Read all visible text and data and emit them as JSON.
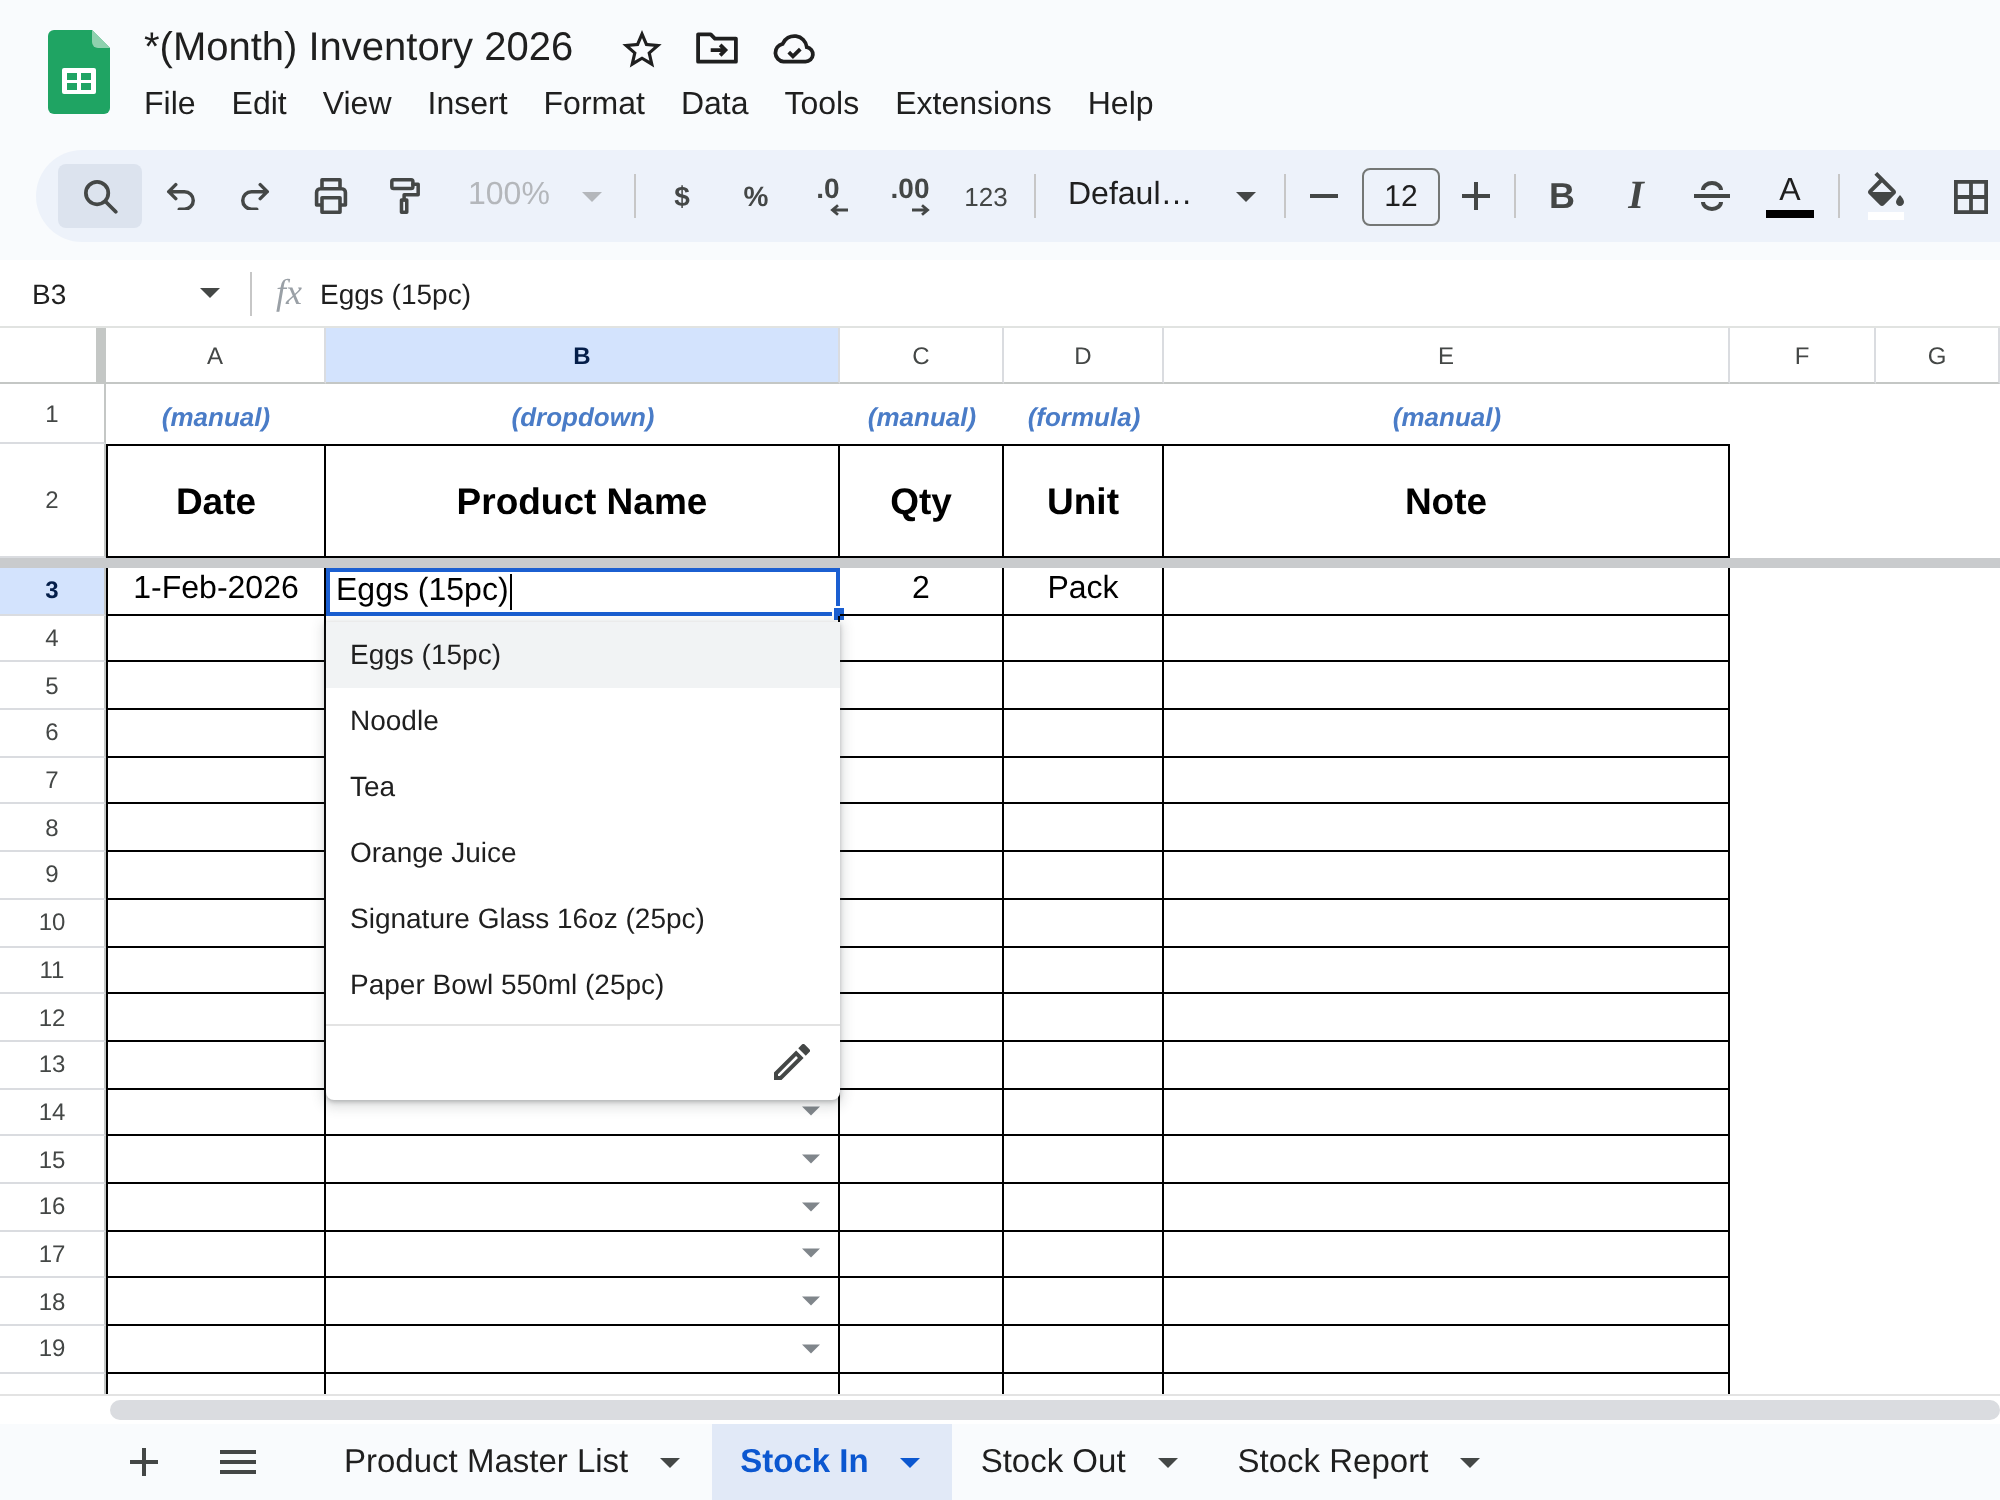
{
  "document": {
    "title": "*(Month) Inventory 2026"
  },
  "menu": [
    "File",
    "Edit",
    "View",
    "Insert",
    "Format",
    "Data",
    "Tools",
    "Extensions",
    "Help"
  ],
  "toolbar": {
    "search": {
      "selected": true
    },
    "zoom": {
      "value": "100%",
      "disabled": true
    },
    "currency": "$",
    "percent": "%",
    "decrease_decimals": ".0",
    "increase_decimals": ".00",
    "number_format": "123",
    "font": "Defaul…",
    "font_size": "12",
    "bold": "B",
    "italic": "I",
    "text_color": "A"
  },
  "formula_bar": {
    "cell_reference": "B3",
    "function_label": "fx",
    "value": "Eggs (15pc)"
  },
  "sheet": {
    "columns": [
      {
        "label": "A",
        "selected": false
      },
      {
        "label": "B",
        "selected": true
      },
      {
        "label": "C",
        "selected": false
      },
      {
        "label": "D",
        "selected": false
      },
      {
        "label": "E",
        "selected": false
      },
      {
        "label": "F",
        "selected": false
      },
      {
        "label": "G",
        "selected": false
      }
    ],
    "rows": [
      {
        "label": "1",
        "kind": "hint",
        "selected": false,
        "dropdown": false,
        "cells": [
          {
            "text": "(manual)",
            "active": false
          },
          {
            "text": "(dropdown)",
            "active": false
          },
          {
            "text": "(manual)",
            "active": false
          },
          {
            "text": "(formula)",
            "active": false
          },
          {
            "text": "(manual)",
            "active": false
          }
        ]
      },
      {
        "label": "2",
        "kind": "header",
        "selected": false,
        "dropdown": false,
        "cells": [
          {
            "text": "Date",
            "active": false
          },
          {
            "text": "Product Name",
            "active": false
          },
          {
            "text": "Qty",
            "active": false
          },
          {
            "text": "Unit",
            "active": false
          },
          {
            "text": "Note",
            "active": false
          }
        ]
      },
      {
        "label": "3",
        "kind": "data",
        "selected": true,
        "dropdown": false,
        "cells": [
          {
            "text": "1-Feb-2026",
            "active": false
          },
          {
            "text": "Eggs (15pc)",
            "active": true
          },
          {
            "text": "2",
            "active": false
          },
          {
            "text": "Pack",
            "active": false
          },
          {
            "active": false
          }
        ]
      },
      {
        "label": "4",
        "kind": "data",
        "selected": false,
        "dropdown": false
      },
      {
        "label": "5",
        "kind": "data",
        "selected": false,
        "dropdown": false
      },
      {
        "label": "6",
        "kind": "data",
        "selected": false,
        "dropdown": false
      },
      {
        "label": "7",
        "kind": "data",
        "selected": false,
        "dropdown": false
      },
      {
        "label": "8",
        "kind": "data",
        "selected": false,
        "dropdown": false
      },
      {
        "label": "9",
        "kind": "data",
        "selected": false,
        "dropdown": false
      },
      {
        "label": "10",
        "kind": "data",
        "selected": false,
        "dropdown": false
      },
      {
        "label": "11",
        "kind": "data",
        "selected": false,
        "dropdown": false
      },
      {
        "label": "12",
        "kind": "data",
        "selected": false,
        "dropdown": false
      },
      {
        "label": "13",
        "kind": "data",
        "selected": false,
        "dropdown": false
      },
      {
        "label": "14",
        "kind": "data",
        "selected": false,
        "dropdown": true
      },
      {
        "label": "15",
        "kind": "data",
        "selected": false,
        "dropdown": true
      },
      {
        "label": "16",
        "kind": "data",
        "selected": false,
        "dropdown": true
      },
      {
        "label": "17",
        "kind": "data",
        "selected": false,
        "dropdown": true
      },
      {
        "label": "18",
        "kind": "data",
        "selected": false,
        "dropdown": true
      },
      {
        "label": "19",
        "kind": "data",
        "selected": false,
        "dropdown": true
      }
    ]
  },
  "dropdown_menu": {
    "options": [
      {
        "label": "Eggs (15pc)",
        "selected": true
      },
      {
        "label": "Noodle",
        "selected": false
      },
      {
        "label": "Tea",
        "selected": false
      },
      {
        "label": "Orange Juice",
        "selected": false
      },
      {
        "label": "Signature Glass 16oz (25pc)",
        "selected": false
      },
      {
        "label": "Paper Bowl 550ml (25pc)",
        "selected": false
      }
    ]
  },
  "sheet_tabs": [
    {
      "label": "Product Master List",
      "selected": false
    },
    {
      "label": "Stock In",
      "selected": true
    },
    {
      "label": "Stock Out",
      "selected": false
    },
    {
      "label": "Stock Report",
      "selected": false
    }
  ]
}
